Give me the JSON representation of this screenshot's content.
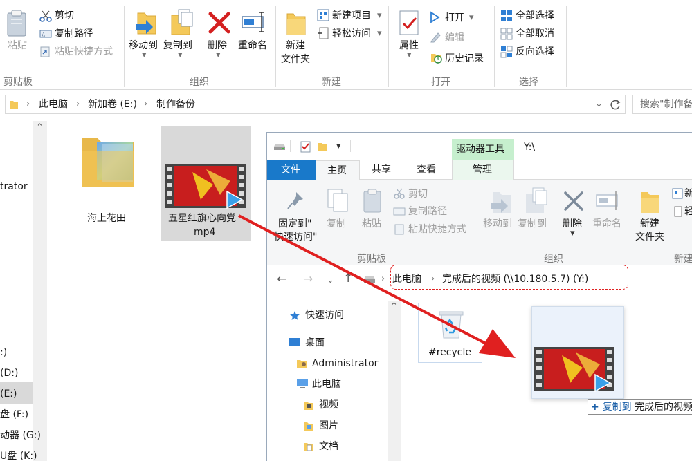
{
  "outer": {
    "ribbon": {
      "cut": "剪切",
      "copy_path": "复制路径",
      "paste_shortcut": "粘贴快捷方式",
      "paste": "粘贴",
      "clipboard_group": "剪贴板",
      "move_to": "移动到",
      "copy_to": "复制到",
      "delete": "删除",
      "rename": "重命名",
      "organize_group": "组织",
      "new_folder_1": "新建",
      "new_folder_2": "文件夹",
      "new_item": "新建项目",
      "easy_access": "轻松访问",
      "new_group": "新建",
      "properties": "属性",
      "open": "打开",
      "edit": "编辑",
      "history": "历史记录",
      "open_group": "打开",
      "select_all": "全部选择",
      "select_none": "全部取消",
      "invert_selection": "反向选择",
      "select_group": "选择"
    },
    "breadcrumb": [
      "此电脑",
      "新加卷 (E:)",
      "制作备份"
    ],
    "search_placeholder": "搜索\"制作备份\"",
    "nav_items": [
      "trator",
      ":)",
      "(D:)",
      "(E:)",
      "盘 (F:)",
      "动器 (G:)",
      "U盘 (K:)"
    ],
    "files": [
      {
        "name": "海上花田"
      },
      {
        "name": "五星红旗心向党",
        "name2": "mp4"
      }
    ]
  },
  "inner": {
    "title_path": "Y:\\",
    "drive_tools": "驱动器工具",
    "tabs": [
      "文件",
      "主页",
      "共享",
      "查看",
      "管理"
    ],
    "ribbon": {
      "pin_1": "固定到\"",
      "pin_2": "快速访问\"",
      "copy": "复制",
      "paste": "粘贴",
      "cut": "剪切",
      "copy_path": "复制路径",
      "paste_shortcut": "粘贴快捷方式",
      "clipboard_group": "剪贴板",
      "move_to": "移动到",
      "copy_to": "复制到",
      "delete": "删除",
      "rename": "重命名",
      "organize_group": "组织",
      "new_folder_1": "新建",
      "new_folder_2": "文件夹",
      "new_item_partial": "新",
      "easy_partial": "轻",
      "new_group_partial": "新建"
    },
    "breadcrumb": [
      "此电脑",
      "完成后的视频 (\\\\10.180.5.7) (Y:)"
    ],
    "nav": [
      "快速访问",
      "桌面",
      "Administrator",
      "此电脑",
      "视频",
      "图片",
      "文档"
    ],
    "recycle": "#recycle",
    "copy_tip_verb": "复制到",
    "copy_tip_target": "完成后的视频"
  },
  "colors": {
    "accent": "#1979ca",
    "drive_tools_bg": "#c6efce",
    "arrow": "#e02020"
  }
}
